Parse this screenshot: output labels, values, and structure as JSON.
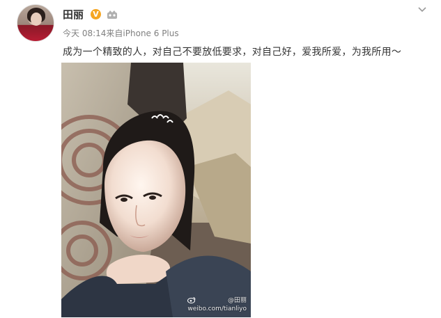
{
  "post": {
    "username": "田丽",
    "vip_badge": "V",
    "timestamp": "今天 08:14",
    "source_prefix": "来自",
    "source": "iPhone 6 Plus",
    "text": "成为一个精致的人，对自己不要放低要求，对自己好，爱我所爱，为我所用～",
    "photo": {
      "watermark_handle": "@田丽",
      "watermark_url": "weibo.com/tianliyo"
    }
  },
  "icons": {
    "avatar": "avatar",
    "vip": "verified-v-icon",
    "level": "level-crown-icon",
    "menu": "chevron-down-icon",
    "weibo_logo": "weibo-logo-icon"
  },
  "colors": {
    "username": "#333333",
    "meta": "#808080",
    "vip_badge": "#f5a623"
  }
}
